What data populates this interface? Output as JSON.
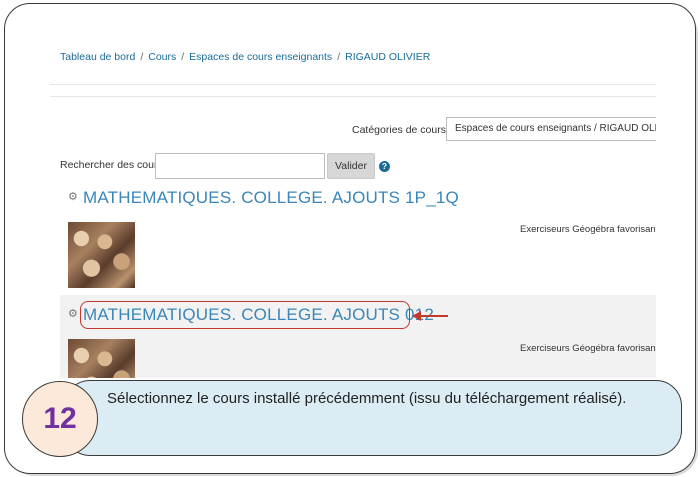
{
  "breadcrumb": {
    "items": [
      "Tableau de bord",
      "Cours",
      "Espaces de cours enseignants",
      "RIGAUD OLIVIER"
    ],
    "separator": "/"
  },
  "categories": {
    "label": "Catégories de cours:",
    "selected": "Espaces de cours enseignants / RIGAUD OLIVIER"
  },
  "search": {
    "label": "Rechercher des cours",
    "value": "",
    "button": "Valider",
    "help_icon": "?"
  },
  "courses": [
    {
      "title": "MATHEMATIQUES. COLLEGE. AJOUTS 1P_1Q",
      "summary": "Exerciseurs Géogébra favorisant",
      "icon": "course-icon"
    },
    {
      "title": "MATHEMATIQUES. COLLEGE. AJOUTS 012",
      "summary": "Exerciseurs Géogébra favorisant",
      "icon": "course-icon"
    }
  ],
  "callout": {
    "step": "12",
    "text": "Sélectionnez le cours installé précédemment (issu du téléchargement réalisé)."
  },
  "colors": {
    "link": "#1a6b9a",
    "course_title": "#3a86b8",
    "highlight": "#c0392b",
    "callout_bg": "#dcecf4",
    "step_bg": "#fde9d9",
    "step_text": "#7030a0"
  }
}
